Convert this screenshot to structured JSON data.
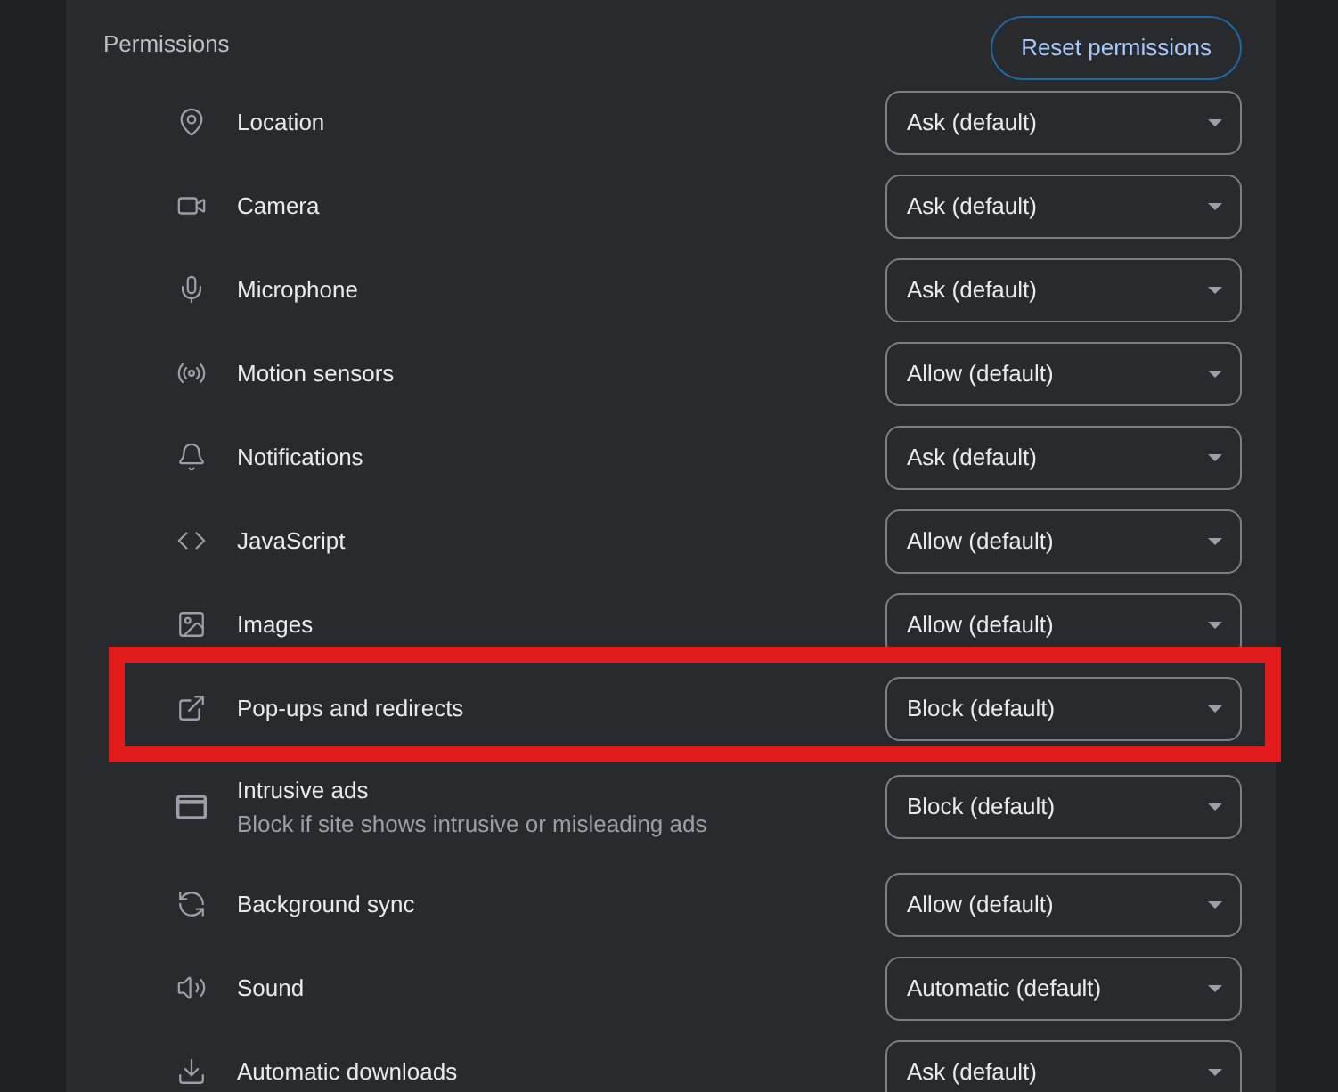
{
  "section": {
    "title": "Permissions",
    "reset_button": "Reset permissions"
  },
  "permissions": [
    {
      "label": "Location",
      "value": "Ask (default)",
      "highlighted": false
    },
    {
      "label": "Camera",
      "value": "Ask (default)",
      "highlighted": false
    },
    {
      "label": "Microphone",
      "value": "Ask (default)",
      "highlighted": false
    },
    {
      "label": "Motion sensors",
      "value": "Allow (default)",
      "highlighted": false
    },
    {
      "label": "Notifications",
      "value": "Ask (default)",
      "highlighted": false
    },
    {
      "label": "JavaScript",
      "value": "Allow (default)",
      "highlighted": false
    },
    {
      "label": "Images",
      "value": "Allow (default)",
      "highlighted": false
    },
    {
      "label": "Pop-ups and redirects",
      "value": "Block (default)",
      "highlighted": true
    },
    {
      "label": "Intrusive ads",
      "description": "Block if site shows intrusive or misleading ads",
      "value": "Block (default)",
      "highlighted": false
    },
    {
      "label": "Background sync",
      "value": "Allow (default)",
      "highlighted": false
    },
    {
      "label": "Sound",
      "value": "Automatic (default)",
      "highlighted": false
    },
    {
      "label": "Automatic downloads",
      "value": "Ask (default)",
      "highlighted": false
    }
  ]
}
